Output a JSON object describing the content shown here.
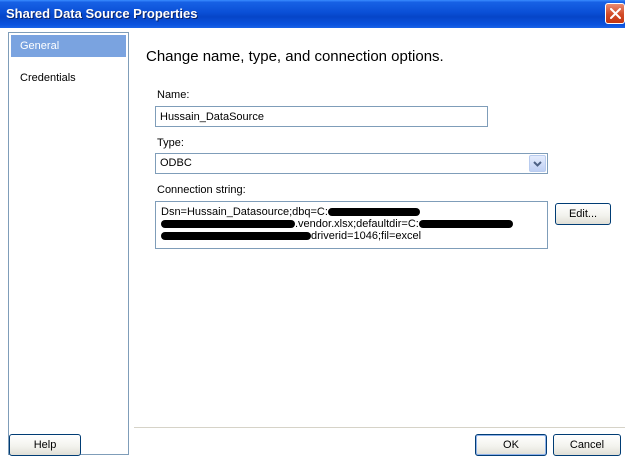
{
  "window": {
    "title": "Shared Data Source Properties",
    "close_icon": "close-icon"
  },
  "sidebar": {
    "items": [
      {
        "label": "General",
        "selected": true
      },
      {
        "label": "Credentials",
        "selected": false
      }
    ]
  },
  "main": {
    "heading": "Change name, type, and connection options.",
    "name_label": "Name:",
    "name_value": "Hussain_DataSource",
    "type_label": "Type:",
    "type_value": "ODBC",
    "connection_label": "Connection string:",
    "connection_lines": {
      "line1": "Dsn=Hussain_Datasource;dbq=C:",
      "line2": ".vendor.xlsx;defaultdir=C:",
      "line3": "driverid=1046;fil=excel"
    },
    "edit_button": "Edit..."
  },
  "footer": {
    "help_button": "Help",
    "ok_button": "OK",
    "cancel_button": "Cancel"
  },
  "colors": {
    "title_bar": "#0a4fd6",
    "selected_item": "#7aa3e0",
    "field_border": "#7f9db9"
  }
}
